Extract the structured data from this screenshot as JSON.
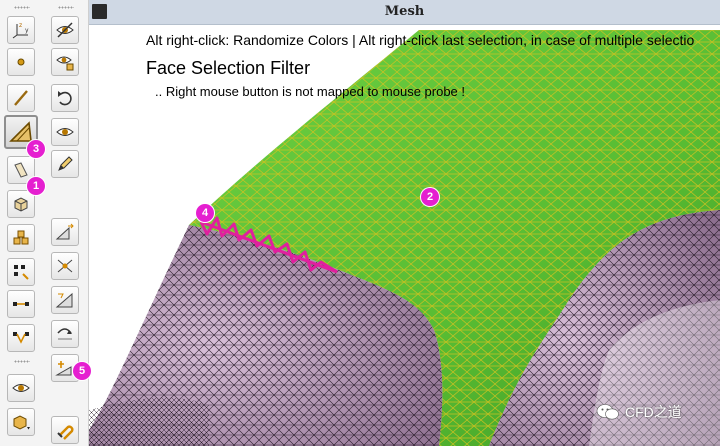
{
  "window": {
    "title": "Mesh"
  },
  "viewport": {
    "hint_text": "Alt right-click: Randomize Colors | Alt right-click last selection, in case of multiple selectio",
    "filter_title": "Face Selection Filter",
    "probe_note": ".. Right mouse button is not mapped to mouse probe !"
  },
  "callouts": [
    "1",
    "2",
    "3",
    "4",
    "5"
  ],
  "watermark": {
    "text": "CFD之道"
  },
  "toolbar_left": [
    {
      "name": "csys-axes-tool",
      "icon": "axes-icon",
      "active": false
    },
    {
      "name": "select-point-tool",
      "icon": "point-icon",
      "active": false
    },
    {
      "name": "select-edge-tool",
      "icon": "edge-icon",
      "active": false
    },
    {
      "name": "select-face-tool",
      "icon": "triangle-face-icon",
      "active": true
    },
    {
      "name": "select-surface-tool",
      "icon": "surface-icon",
      "active": false
    },
    {
      "name": "select-volume-tool",
      "icon": "cube-icon",
      "active": false
    },
    {
      "name": "select-parts-tool",
      "icon": "multi-cube-icon",
      "active": false
    },
    {
      "name": "node-operations-tool",
      "icon": "nodes-icon",
      "active": false
    },
    {
      "name": "edge-split-tool",
      "icon": "edge-split-icon",
      "active": false
    },
    {
      "name": "edge-merge-tool",
      "icon": "edge-merge-icon",
      "active": false
    },
    {
      "name": "view-options-tool",
      "icon": "eye-icon",
      "active": false
    },
    {
      "name": "cube-options-tool",
      "icon": "cube-dropdown-icon",
      "active": false
    }
  ],
  "toolbar_right": [
    {
      "name": "visibility-tool",
      "icon": "eye-slash-icon"
    },
    {
      "name": "show-only-tool",
      "icon": "eye-box-icon"
    },
    {
      "name": "undo-tool",
      "icon": "undo-icon"
    },
    {
      "name": "view-tool",
      "icon": "eye-icon"
    },
    {
      "name": "edit-tool",
      "icon": "pencil-icon"
    },
    {
      "name": "split-face-tool",
      "icon": "split-face-icon"
    },
    {
      "name": "collapse-tool",
      "icon": "collapse-icon"
    },
    {
      "name": "swap-edge-tool",
      "icon": "swap-edge-icon"
    },
    {
      "name": "reshape-tool",
      "icon": "reshape-icon"
    },
    {
      "name": "move-node-tool",
      "icon": "move-node-icon"
    },
    {
      "name": "magnet-tool",
      "icon": "magnet-icon"
    }
  ],
  "colors": {
    "face_green": "#5fc43a",
    "mesh_line": "#d6c21a",
    "solid_lilac": "#c5a7c6",
    "selection_magenta": "#e0209e",
    "callout": "#e51fd0"
  }
}
